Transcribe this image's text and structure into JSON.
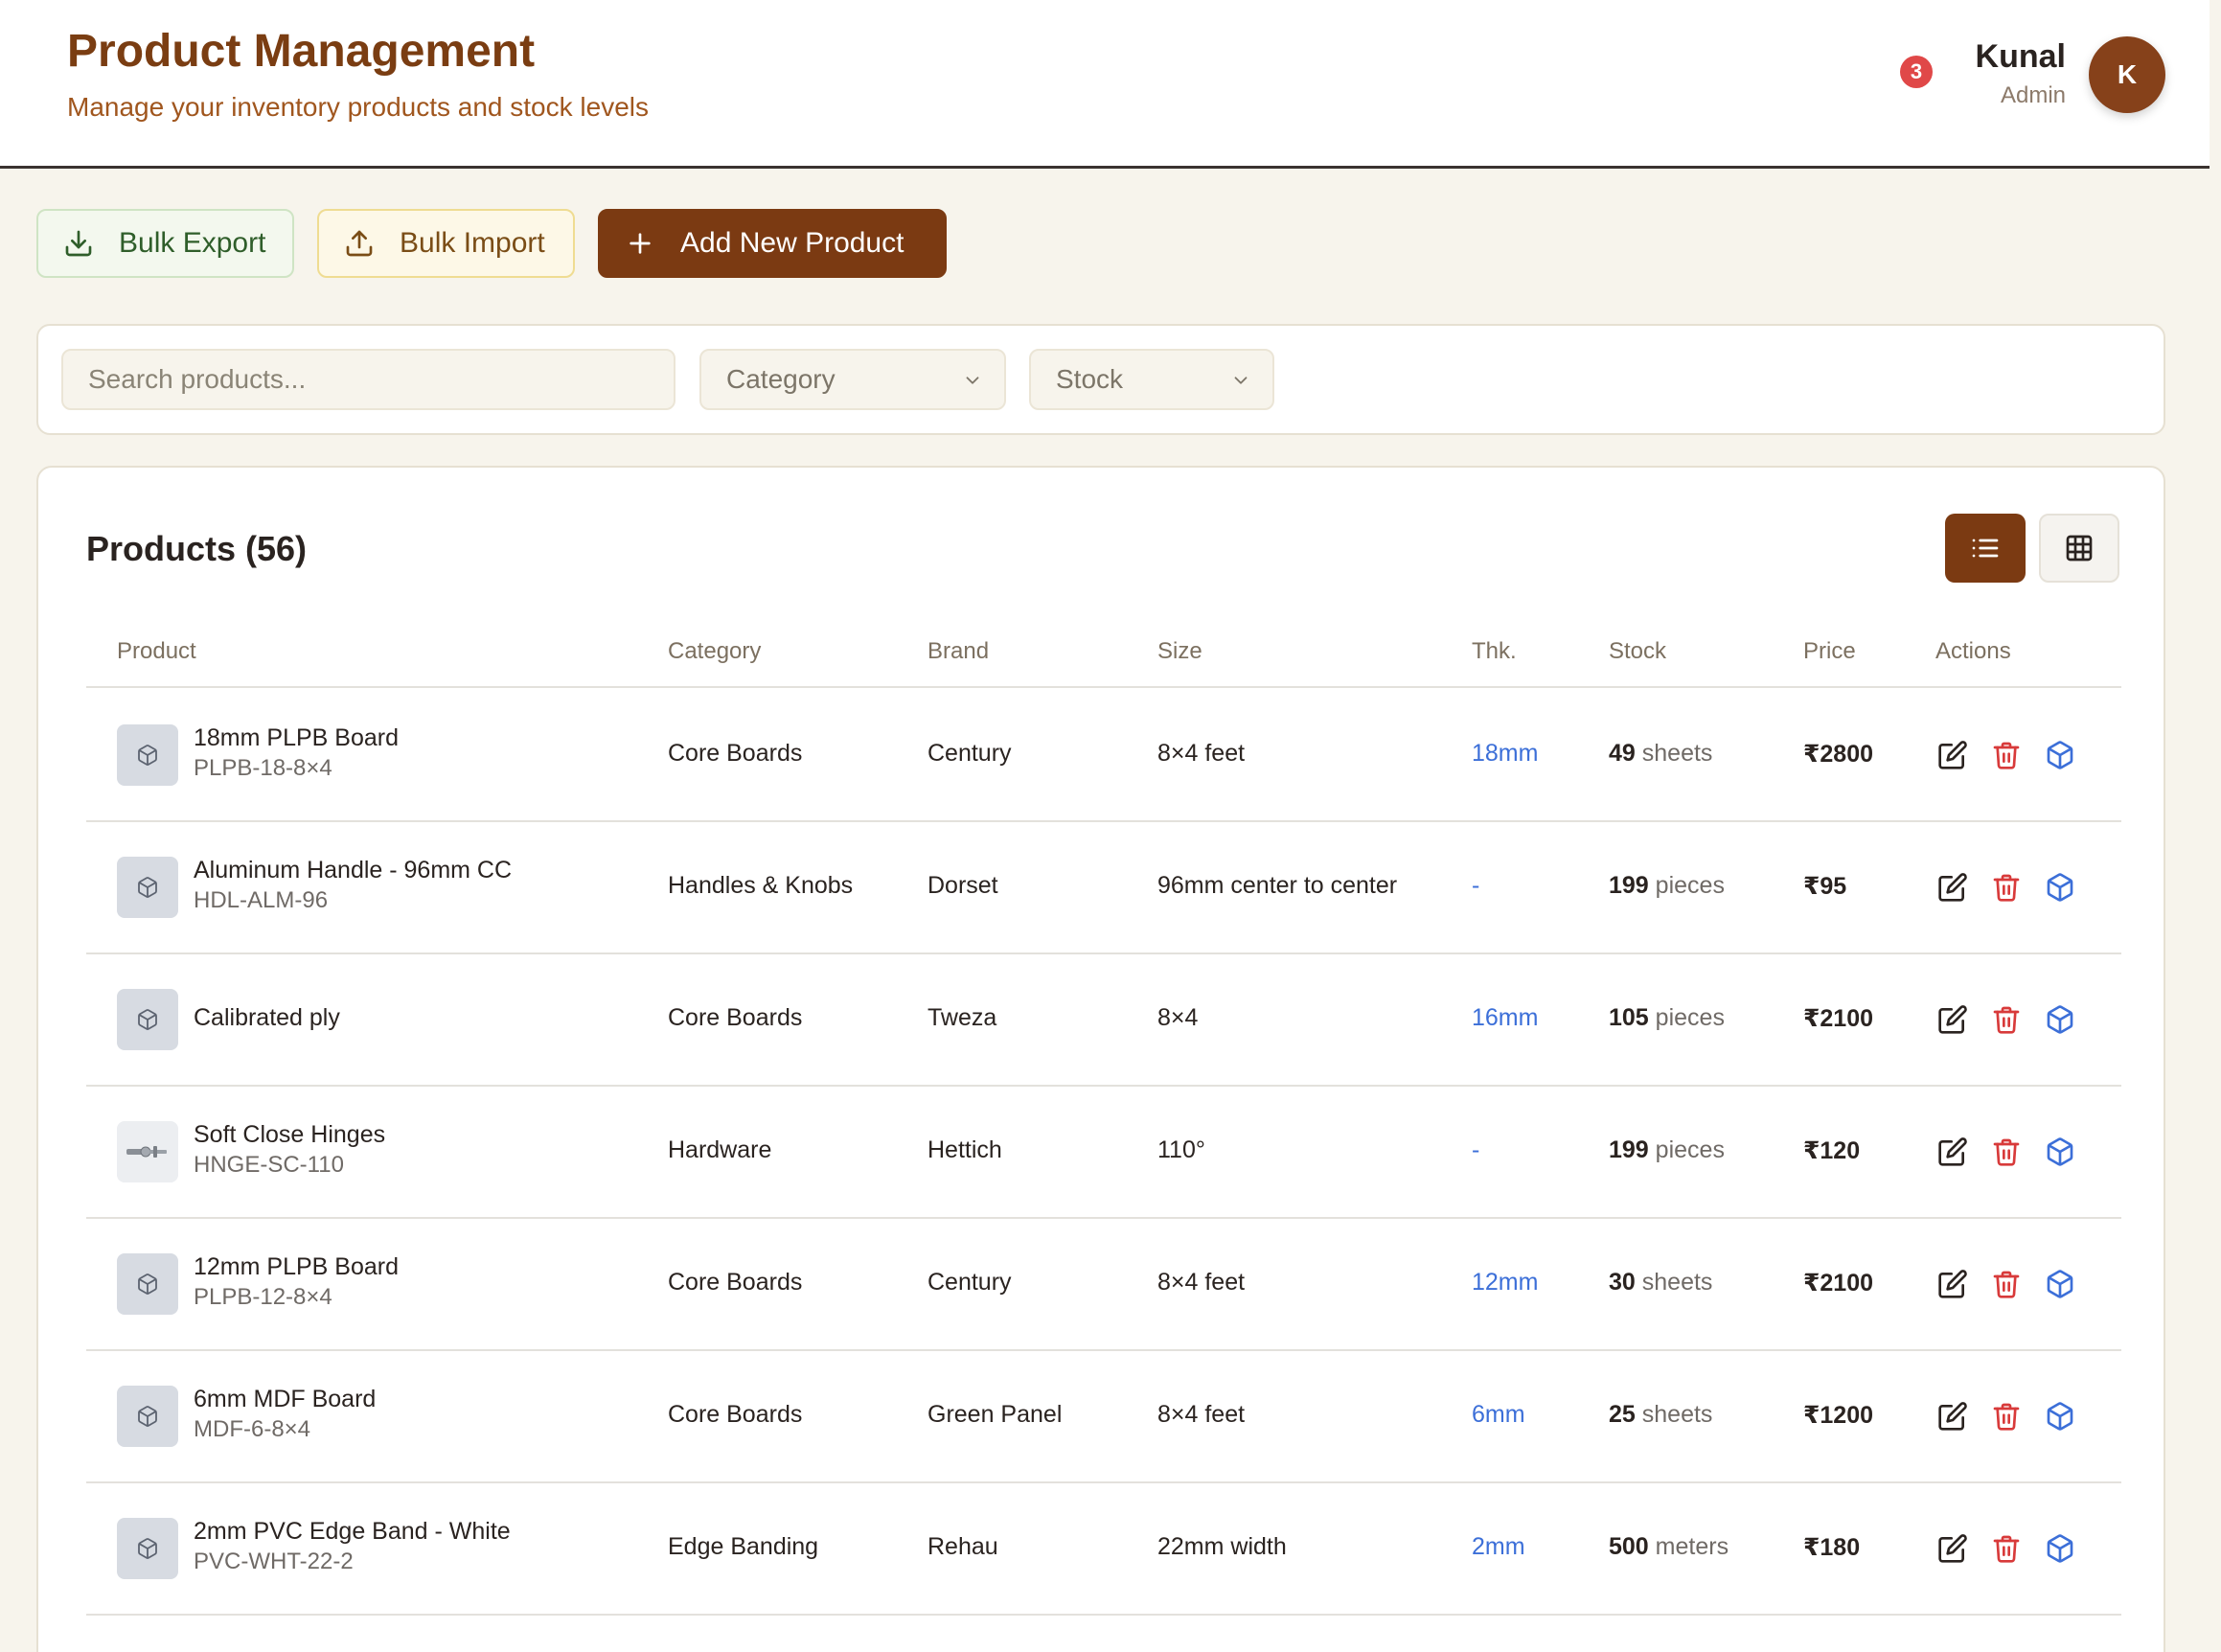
{
  "header": {
    "title": "Product Management",
    "subtitle": "Manage your inventory products and stock levels",
    "notification_count": "3",
    "user": {
      "name": "Kunal",
      "role": "Admin",
      "initial": "K"
    }
  },
  "actions": {
    "bulk_export": "Bulk Export",
    "bulk_import": "Bulk Import",
    "add_new": "Add New Product"
  },
  "filters": {
    "search_placeholder": "Search products...",
    "category": "Category",
    "stock": "Stock"
  },
  "products": {
    "title": "Products (56)",
    "columns": [
      "Product",
      "Category",
      "Brand",
      "Size",
      "Thk.",
      "Stock",
      "Price",
      "Actions"
    ],
    "rows": [
      {
        "name": "18mm PLPB Board",
        "sku": "PLPB-18-8×4",
        "category": "Core Boards",
        "brand": "Century",
        "size": "8×4 feet",
        "thk": "18mm",
        "stock": "49",
        "unit": "sheets",
        "price": "₹2800",
        "thumb": "box-icon"
      },
      {
        "name": "Aluminum Handle - 96mm CC",
        "sku": "HDL-ALM-96",
        "category": "Handles & Knobs",
        "brand": "Dorset",
        "size": "96mm center to center",
        "thk": "-",
        "stock": "199",
        "unit": "pieces",
        "price": "₹95",
        "thumb": "box-icon"
      },
      {
        "name": "Calibrated ply",
        "sku": "",
        "category": "Core Boards",
        "brand": "Tweza",
        "size": "8×4",
        "thk": "16mm",
        "stock": "105",
        "unit": "pieces",
        "price": "₹2100",
        "thumb": "box-icon"
      },
      {
        "name": "Soft Close Hinges",
        "sku": "HNGE-SC-110",
        "category": "Hardware",
        "brand": "Hettich",
        "size": "110°",
        "thk": "-",
        "stock": "199",
        "unit": "pieces",
        "price": "₹120",
        "thumb": "hinge-photo"
      },
      {
        "name": "12mm PLPB Board",
        "sku": "PLPB-12-8×4",
        "category": "Core Boards",
        "brand": "Century",
        "size": "8×4 feet",
        "thk": "12mm",
        "stock": "30",
        "unit": "sheets",
        "price": "₹2100",
        "thumb": "box-icon"
      },
      {
        "name": "6mm MDF Board",
        "sku": "MDF-6-8×4",
        "category": "Core Boards",
        "brand": "Green Panel",
        "size": "8×4 feet",
        "thk": "6mm",
        "stock": "25",
        "unit": "sheets",
        "price": "₹1200",
        "thumb": "box-icon"
      },
      {
        "name": "2mm PVC Edge Band - White",
        "sku": "PVC-WHT-22-2",
        "category": "Edge Banding",
        "brand": "Rehau",
        "size": "22mm width",
        "thk": "2mm",
        "stock": "500",
        "unit": "meters",
        "price": "₹180",
        "thumb": "box-icon"
      }
    ]
  },
  "colors": {
    "brand": "#7b3a12",
    "accent_thk": "#3c6fd8",
    "delete": "#d83a3a",
    "badge": "#e04848"
  }
}
